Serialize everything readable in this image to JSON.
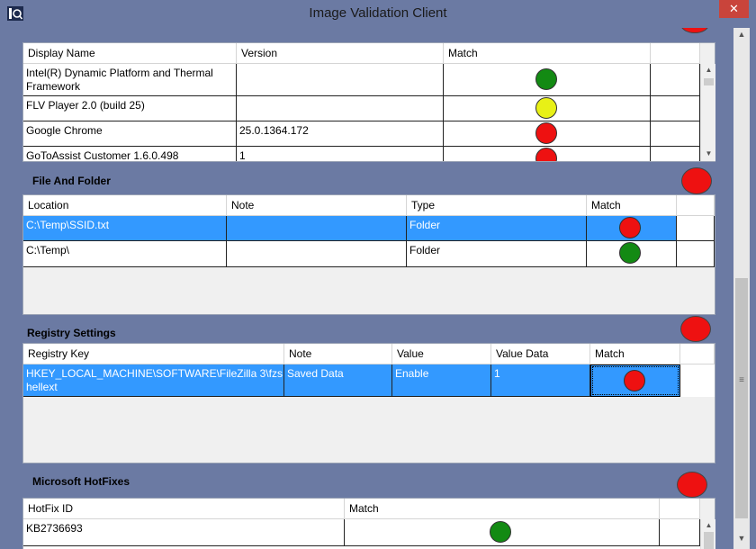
{
  "window": {
    "title": "Image Validation Client",
    "close_glyph": "✕"
  },
  "applications": {
    "columns": [
      "Display Name",
      "Version",
      "Match"
    ],
    "rows": [
      {
        "name": "Intel(R) Dynamic Platform and Thermal Framework",
        "version": "",
        "match": "green"
      },
      {
        "name": "FLV Player 2.0 (build 25)",
        "version": "",
        "match": "yellow"
      },
      {
        "name": "Google Chrome",
        "version": "25.0.1364.172",
        "match": "red"
      },
      {
        "name": "GoToAssist Customer 1.6.0.498",
        "version": "1",
        "match": "red"
      }
    ]
  },
  "files": {
    "title": "File And Folder",
    "status": "red",
    "columns": [
      "Location",
      "Note",
      "Type",
      "Match"
    ],
    "rows": [
      {
        "location": "C:\\Temp\\SSID.txt",
        "note": "",
        "type": "Folder",
        "match": "red"
      },
      {
        "location": "C:\\Temp\\",
        "note": "",
        "type": "Folder",
        "match": "green"
      }
    ]
  },
  "registry": {
    "title": "Registry Settings",
    "status": "red",
    "columns": [
      "Registry Key",
      "Note",
      "Value",
      "Value Data",
      "Match"
    ],
    "rows": [
      {
        "key": "HKEY_LOCAL_MACHINE\\SOFTWARE\\FileZilla 3\\fzshellext",
        "note": "Saved Data",
        "value": "Enable",
        "value_data": "1",
        "match": "red"
      }
    ]
  },
  "hotfixes": {
    "title": "Microsoft HotFixes",
    "status": "red",
    "columns": [
      "HotFix ID",
      "Match"
    ],
    "rows": [
      {
        "id": "KB2736693",
        "match": "green"
      }
    ]
  },
  "colors": {
    "red": "#ee1111",
    "green": "#138a13",
    "yellow": "#e8f016",
    "selection": "#3399ff",
    "window": "#6b7aa3"
  },
  "icons": {
    "app": "app-icon",
    "close": "close-icon",
    "status": "status-indicator-icon",
    "scroll_up": "scroll-up-arrow-icon",
    "scroll_down": "scroll-down-arrow-icon"
  }
}
